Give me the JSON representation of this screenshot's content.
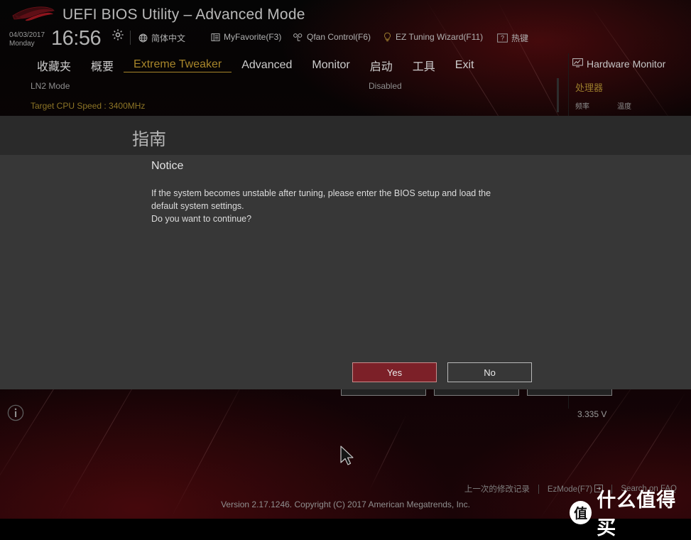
{
  "header": {
    "logo": "rog-eye-logo",
    "title": "UEFI BIOS Utility – Advanced Mode",
    "date": "04/03/2017",
    "weekday": "Monday",
    "time": "16:56",
    "gear_icon": "gear-icon",
    "menu": [
      {
        "icon": "globe-icon",
        "label": "简体中文"
      },
      {
        "icon": "list-icon",
        "label": "MyFavorite(F3)"
      },
      {
        "icon": "fan-icon",
        "label": "Qfan Control(F6)"
      },
      {
        "icon": "bulb-icon",
        "label": "EZ Tuning Wizard(F11)"
      },
      {
        "icon": "question-box-icon",
        "label": "热键"
      }
    ]
  },
  "nav": {
    "tabs": [
      {
        "label": "收藏夹",
        "active": false
      },
      {
        "label": "概要",
        "active": false
      },
      {
        "label": "Extreme Tweaker",
        "active": true
      },
      {
        "label": "Advanced",
        "active": false
      },
      {
        "label": "Monitor",
        "active": false
      },
      {
        "label": "启动",
        "active": false
      },
      {
        "label": "工具",
        "active": false
      },
      {
        "label": "Exit",
        "active": false
      }
    ],
    "active_color": "#a8862a"
  },
  "settings": {
    "rows": [
      {
        "label": "LN2 Mode",
        "value": "Disabled"
      }
    ],
    "target_cpu_speed": "Target CPU Speed : 3400MHz",
    "target_color": "#8d7526"
  },
  "hardware_monitor": {
    "icon": "monitor-icon",
    "title": "Hardware Monitor",
    "section": "处理器",
    "section_color": "#9a7c2b",
    "columns": [
      "频率",
      "温度"
    ],
    "values": [
      {
        "text": "3.335 V"
      }
    ]
  },
  "dialog": {
    "title": "指南",
    "heading": "Notice",
    "body_lines": [
      "If the system becomes unstable after tuning, please enter the BIOS setup and load the",
      "default system settings.",
      "Do you want to continue?"
    ],
    "buttons": {
      "yes": "Yes",
      "no": "No"
    },
    "yes_color": "#7c2028",
    "bg_color": "#373737",
    "titlebar_color": "#2a2a2a"
  },
  "info_icon": "info-circle-icon",
  "footer": {
    "links": [
      {
        "label": "上一次的修改记录"
      },
      {
        "label": "EzMode(F7)",
        "icon": "arrow-right-box-icon"
      },
      {
        "label": "Search on FAQ"
      }
    ],
    "version": "Version 2.17.1246. Copyright (C) 2017 American Megatrends, Inc."
  },
  "watermark": {
    "badge": "值",
    "text": "什么值得买"
  },
  "cursor": "mouse-pointer-arrow"
}
